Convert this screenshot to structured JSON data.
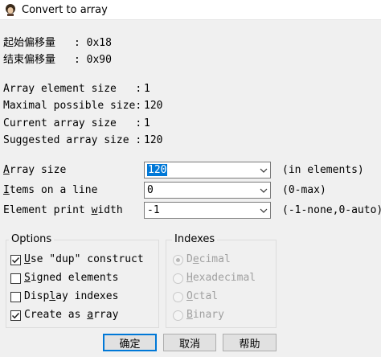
{
  "window": {
    "title": "Convert to array"
  },
  "offsets": {
    "start_label": "起始偏移量",
    "start_value": ": 0x18",
    "end_label": "结束偏移量",
    "end_value": ": 0x90"
  },
  "info": {
    "element_size_label": "Array element size   :",
    "element_size_value": "1",
    "max_size_label": "Maximal possible size:",
    "max_size_value": "120",
    "current_size_label": "Current array size   :",
    "current_size_value": "1",
    "suggested_size_label": "Suggested array size :",
    "suggested_size_value": "120"
  },
  "fields": {
    "array_size": {
      "label_u": "A",
      "label_rest": "rray size",
      "value": "120",
      "hint": "(in elements)"
    },
    "items_per_line": {
      "label_u": "I",
      "label_rest": "tems on a line",
      "value": "0",
      "hint": "(0-max)"
    },
    "print_width": {
      "label_pre": "Element print ",
      "label_u": "w",
      "label_rest": "idth",
      "value": "-1",
      "hint": "(-1-none,0-auto)"
    }
  },
  "options": {
    "title": "Options",
    "items": [
      {
        "pre": "",
        "u": "U",
        "rest": "se \"dup\" construct",
        "checked": true
      },
      {
        "pre": "",
        "u": "S",
        "rest": "igned elements",
        "checked": false
      },
      {
        "pre": "Disp",
        "u": "l",
        "rest": "ay indexes",
        "checked": false
      },
      {
        "pre": "Create as ",
        "u": "a",
        "rest": "rray",
        "checked": true
      }
    ]
  },
  "indexes": {
    "title": "Indexes",
    "items": [
      {
        "pre": "D",
        "u": "e",
        "rest": "cimal",
        "selected": true
      },
      {
        "pre": "",
        "u": "H",
        "rest": "exadecimal",
        "selected": false
      },
      {
        "pre": "",
        "u": "O",
        "rest": "ctal",
        "selected": false
      },
      {
        "pre": "",
        "u": "B",
        "rest": "inary",
        "selected": false
      }
    ]
  },
  "buttons": {
    "ok": "确定",
    "cancel": "取消",
    "help": "帮助"
  },
  "colors": {
    "accent": "#0078d7",
    "background": "#f0f0f0"
  }
}
